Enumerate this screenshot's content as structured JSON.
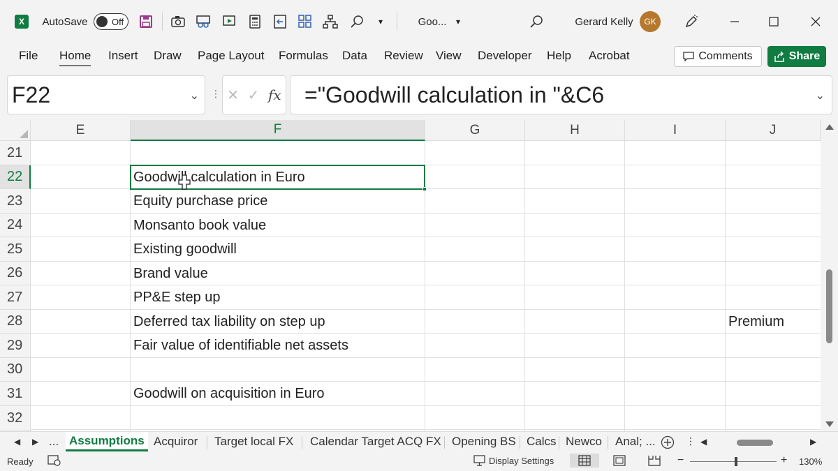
{
  "titlebar": {
    "app_icon": "excel-icon",
    "autosave_label": "AutoSave",
    "autosave_state": "Off",
    "file_name": "Goo...",
    "user_name": "Gerard Kelly",
    "user_initials": "GK"
  },
  "menu": {
    "items": [
      "File",
      "Home",
      "Insert",
      "Draw",
      "Page Layout",
      "Formulas",
      "Data",
      "Review",
      "View",
      "Developer",
      "Help",
      "Acrobat"
    ],
    "active": "Home",
    "comments_label": "Comments",
    "share_label": "Share"
  },
  "formula_bar": {
    "name_box": "F22",
    "fx_label": "fx",
    "formula": "=\"Goodwill calculation in \"&C6"
  },
  "grid": {
    "columns": [
      "E",
      "F",
      "G",
      "H",
      "I",
      "J"
    ],
    "selected_column": "F",
    "rows": [
      "21",
      "22",
      "23",
      "24",
      "25",
      "26",
      "27",
      "28",
      "29",
      "30",
      "31",
      "32"
    ],
    "selected_row": "22",
    "cells": {
      "F22": "Goodwill calculation in Euro",
      "F23": "Equity purchase price",
      "F24": "Monsanto book value",
      "F25": "Existing goodwill",
      "F26": "Brand value",
      "F27": "PP&E step up",
      "F28": "Deferred tax liability on step up",
      "J28": "Premium",
      "F29": "Fair value of identifiable net assets",
      "F31": "Goodwill on acquisition in Euro"
    }
  },
  "sheet_tabs": {
    "ellipsis": "...",
    "tabs": [
      "Assumptions",
      "Acquiror",
      "Target local FX",
      "Calendar Target ACQ FX",
      "Opening BS",
      "Calcs",
      "Newco",
      "Anal; ..."
    ],
    "active": "Assumptions"
  },
  "statusbar": {
    "ready": "Ready",
    "display_settings": "Display Settings",
    "zoom": "130%",
    "zoom_minus": "−",
    "zoom_plus": "+"
  },
  "colors": {
    "accent": "#107c41",
    "avatar": "#b5782d"
  }
}
